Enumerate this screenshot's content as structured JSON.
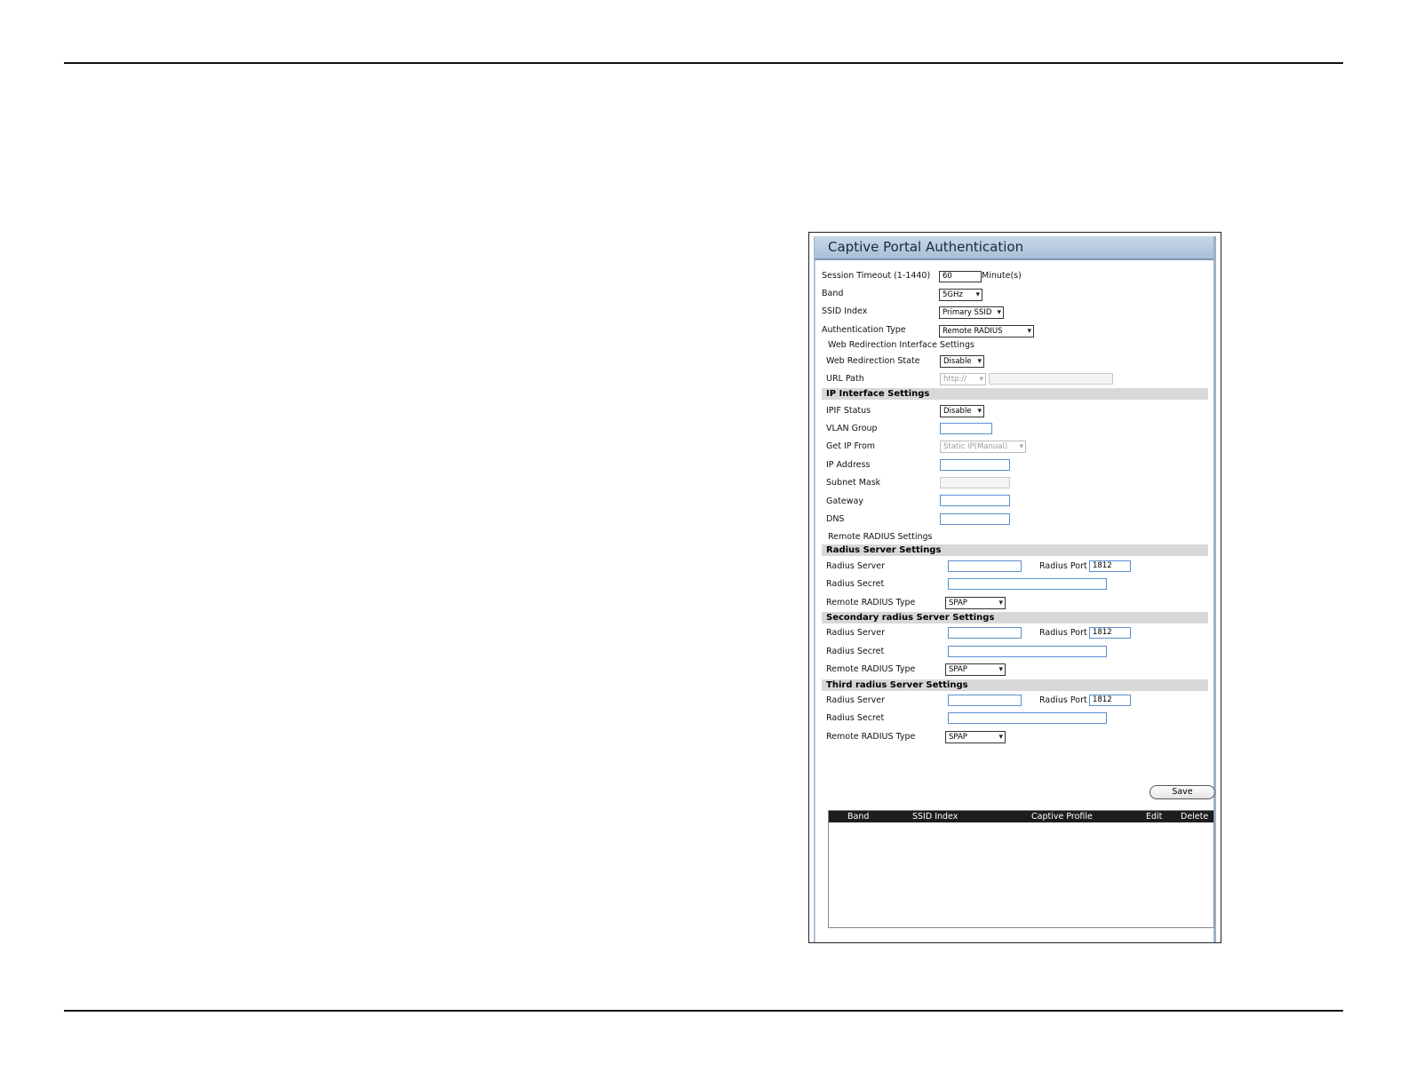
{
  "panel": {
    "title": "Captive Portal Authentication",
    "session_timeout": {
      "label": "Session Timeout (1-1440)",
      "value": "60",
      "unit": "Minute(s)"
    },
    "band": {
      "label": "Band",
      "value": "5GHz"
    },
    "ssid_index": {
      "label": "SSID Index",
      "value": "Primary SSID"
    },
    "auth_type": {
      "label": "Authentication Type",
      "value": "Remote RADIUS"
    },
    "web_redirection_heading": "Web Redirection Interface Settings",
    "web_redirection_state": {
      "label": "Web Redirection State",
      "value": "Disable"
    },
    "url_path": {
      "label": "URL Path",
      "protocol": "http://",
      "value": ""
    },
    "ip_interface": {
      "heading": "IP Interface Settings",
      "ipif_status": {
        "label": "IPIF Status",
        "value": "Disable"
      },
      "vlan_group": {
        "label": "VLAN Group",
        "value": ""
      },
      "get_ip_from": {
        "label": "Get IP From",
        "value": "Static IP(Manual)"
      },
      "ip_address": {
        "label": "IP Address",
        "value": ""
      },
      "subnet_mask": {
        "label": "Subnet Mask",
        "value": ""
      },
      "gateway": {
        "label": "Gateway",
        "value": ""
      },
      "dns": {
        "label": "DNS",
        "value": ""
      }
    },
    "remote_radius_heading": "Remote RADIUS Settings",
    "radius_primary": {
      "heading": "Radius Server Settings",
      "server_label": "Radius Server",
      "server_value": "",
      "port_label": "Radius Port",
      "port_value": "1812",
      "secret_label": "Radius Secret",
      "secret_value": "",
      "type_label": "Remote RADIUS Type",
      "type_value": "SPAP"
    },
    "radius_secondary": {
      "heading": "Secondary radius Server Settings",
      "server_label": "Radius Server",
      "server_value": "",
      "port_label": "Radius Port",
      "port_value": "1812",
      "secret_label": "Radius Secret",
      "secret_value": "",
      "type_label": "Remote RADIUS Type",
      "type_value": "SPAP"
    },
    "radius_third": {
      "heading": "Third radius Server Settings",
      "server_label": "Radius Server",
      "server_value": "",
      "port_label": "Radius Port",
      "port_value": "1812",
      "secret_label": "Radius Secret",
      "secret_value": "",
      "type_label": "Remote RADIUS Type",
      "type_value": "SPAP"
    },
    "save_label": "Save",
    "table": {
      "columns": [
        "Band",
        "SSID Index",
        "Captive Profile",
        "Edit",
        "Delete"
      ],
      "rows": []
    }
  },
  "colors": {
    "panel_bg": "#dbe5ef",
    "title_bar": "#a9bfd6",
    "input_border": "#5a8fd0",
    "table_header": "#1d1d1d"
  }
}
